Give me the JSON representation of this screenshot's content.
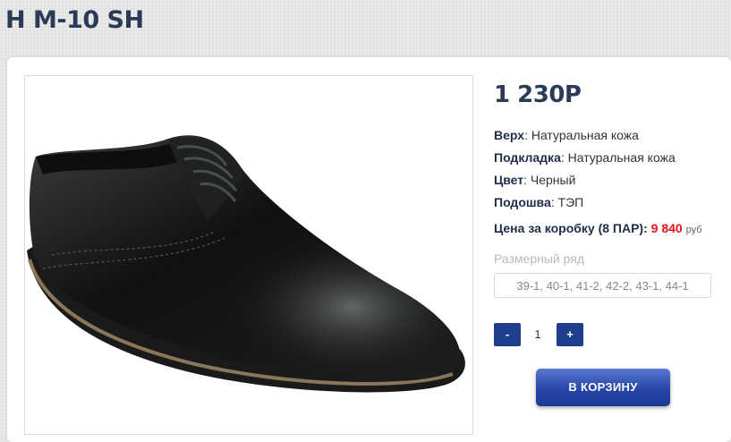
{
  "product": {
    "title": "Н М-10 SH",
    "price": "1 230Р",
    "specs": [
      {
        "label": "Верх",
        "value": "Натуральная кожа"
      },
      {
        "label": "Подкладка",
        "value": "Натуральная кожа"
      },
      {
        "label": "Цвет",
        "value": "Черный"
      },
      {
        "label": "Подошва",
        "value": "ТЭП"
      }
    ],
    "box_price": {
      "label": "Цена за коробку (8 ПАР):",
      "value": "9 840",
      "currency": "руб"
    },
    "size_label": "Размерный ряд",
    "sizes": "39-1, 40-1, 41-2, 42-2, 43-1, 44-1"
  },
  "quantity": {
    "minus": "-",
    "value": "1",
    "plus": "+"
  },
  "cart_button": "В КОРЗИНУ",
  "colors": {
    "accent": "#1e3e8e",
    "price_red": "#e0161b",
    "title": "#2b3a57"
  }
}
